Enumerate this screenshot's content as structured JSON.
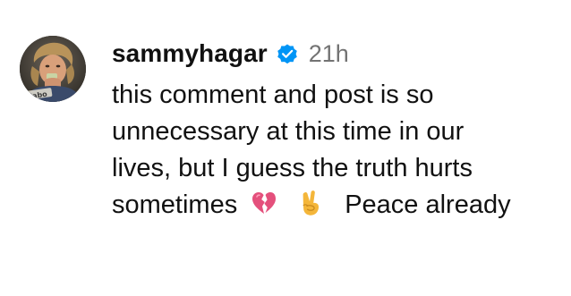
{
  "comment": {
    "username": "sammyhagar",
    "timestamp": "21h",
    "avatar_caption": "Cabo",
    "icons": {
      "verified": "verified-badge-icon",
      "broken_heart": "broken-heart-emoji",
      "peace": "victory-hand-emoji"
    },
    "colors": {
      "verified_blue": "#0095f6",
      "timestamp_gray": "#737373",
      "text": "#111111"
    },
    "lines": [
      "this comment and post is so",
      "unnecessary at this time in our",
      "lives, but I guess the truth hurts"
    ],
    "last_line_start": "sometimes",
    "last_line_end": "Peace already"
  }
}
